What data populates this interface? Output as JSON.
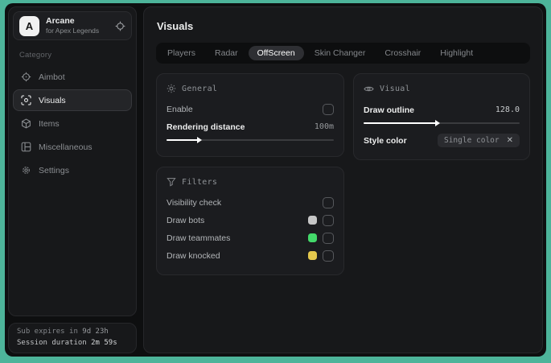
{
  "app": {
    "logo_letter": "A",
    "name": "Arcane",
    "subtitle": "for Apex Legends"
  },
  "sidebar": {
    "category_label": "Category",
    "items": [
      {
        "label": "Aimbot"
      },
      {
        "label": "Visuals"
      },
      {
        "label": "Items"
      },
      {
        "label": "Miscellaneous"
      },
      {
        "label": "Settings"
      }
    ],
    "session": {
      "expires_label": "Sub expires in",
      "expires_value": "9d 23h",
      "duration_label": "Session duration",
      "duration_value": "2m 59s"
    }
  },
  "main": {
    "title": "Visuals",
    "tabs": [
      "Players",
      "Radar",
      "OffScreen",
      "Skin Changer",
      "Crosshair",
      "Highlight"
    ],
    "active_tab": "OffScreen"
  },
  "cards": {
    "general": {
      "title": "General",
      "enable_label": "Enable",
      "distance_label": "Rendering distance",
      "distance_value": "100m",
      "distance_fill": "width:20%"
    },
    "visual": {
      "title": "Visual",
      "outline_label": "Draw outline",
      "outline_value": "128.0",
      "outline_fill": "width:48%",
      "style_color_label": "Style color",
      "style_color_value": "Single color",
      "style_color_remove": "✕"
    },
    "filters": {
      "title": "Filters",
      "rows": [
        {
          "label": "Visibility check"
        },
        {
          "label": "Draw bots",
          "swatch_color": "#c6c6c6",
          "swatch": "background:#c6c6c6"
        },
        {
          "label": "Draw teammates",
          "swatch_color": "#43d96a",
          "swatch": "background:#43d96a"
        },
        {
          "label": "Draw knocked",
          "swatch_color": "#e4c84d",
          "swatch": "background:#e4c84d"
        }
      ]
    }
  },
  "colors": {
    "wallpaper_teal": "#4db49a",
    "wallpaper_orange": "#e8563c",
    "panel_bg": "#17181a",
    "card_bg": "#1b1c1f",
    "text_primary": "#eceded",
    "text_secondary": "#8b8e92"
  }
}
